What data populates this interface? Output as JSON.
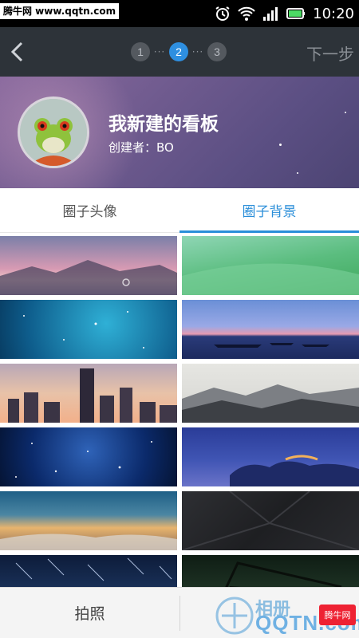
{
  "watermark_top": "腾牛网 www.qqtn.com",
  "status_bar": {
    "time": "10:20"
  },
  "nav": {
    "steps": [
      "1",
      "2",
      "3"
    ],
    "active_step": "2",
    "next_label": "下一步"
  },
  "board": {
    "title": "我新建的看板",
    "creator": "创建者：BO"
  },
  "tabs": [
    {
      "label": "圈子头像",
      "active": false
    },
    {
      "label": "圈子背景",
      "active": true
    }
  ],
  "bottom": {
    "camera_label": "拍照",
    "album_label": "相册"
  },
  "watermark_bottom": {
    "site": "QQTN.com",
    "badge": "腾牛网"
  },
  "colors": {
    "accent": "#2a8ed9",
    "nav_bg": "#2d3339"
  }
}
